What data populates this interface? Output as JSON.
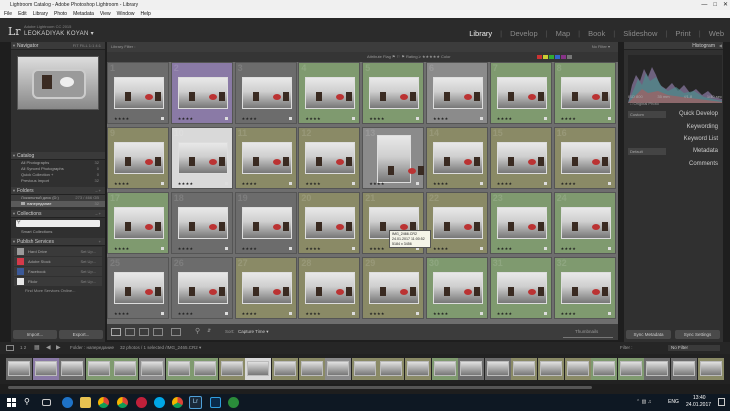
{
  "window": {
    "title": "Lightroom Catalog - Adobe Photoshop Lightroom - Library"
  },
  "menu": [
    "File",
    "Edit",
    "Library",
    "Photo",
    "Metadata",
    "View",
    "Window",
    "Help"
  ],
  "identity": {
    "product": "Adobe Lightroom CC 2015",
    "user": "LEOKADIYAK KOYAN ▾"
  },
  "modules": [
    {
      "label": "Library",
      "active": true
    },
    {
      "label": "Develop"
    },
    {
      "label": "Map"
    },
    {
      "label": "Book"
    },
    {
      "label": "Slideshow"
    },
    {
      "label": "Print"
    },
    {
      "label": "Web"
    }
  ],
  "left": {
    "navigator": "Navigator",
    "nav_opts": "FIT   FILL   1:1   4:1",
    "catalog": "Catalog",
    "catalog_items": [
      {
        "label": "All Photographs",
        "count": "32"
      },
      {
        "label": "All Synced Photographs",
        "count": "0"
      },
      {
        "label": "Quick Collection +",
        "count": "0"
      },
      {
        "label": "Previous Import",
        "count": "32"
      }
    ],
    "folders": "Folders",
    "volume": "Локальный диск (D:)",
    "volume_space": "273 / 466 GB",
    "folder": "напередание",
    "folder_count": "32",
    "collections": "Collections",
    "smart_collections": "Smart Collections",
    "publish": "Publish Services",
    "services": [
      {
        "label": "Hard Drive",
        "state": "Set Up..."
      },
      {
        "label": "Adobe Stock",
        "state": "Set Up..."
      },
      {
        "label": "Facebook",
        "state": "Set Up..."
      },
      {
        "label": "Flickr",
        "state": "Set Up..."
      }
    ],
    "find_more": "Find More Services Online...",
    "import": "Import...",
    "export": "Export..."
  },
  "filter": {
    "label": "Library Filter :",
    "tabs": [
      "Text",
      "Attribute",
      "Metadata",
      "None"
    ],
    "active": "Attribute",
    "nofilter": "No Filter ▾",
    "attr_row": "Attribute   Flag  ⚑ ⚐ ⚑   Rating  ≥ ★★★★★   Color"
  },
  "grid": {
    "cells": [
      {
        "n": "1",
        "c": "#6c6c6c",
        "t": "land"
      },
      {
        "n": "2",
        "c": "#8a7aa6",
        "t": "land"
      },
      {
        "n": "3",
        "c": "#6c6c6c",
        "t": "land"
      },
      {
        "n": "4",
        "c": "#7f9a6f",
        "t": "land"
      },
      {
        "n": "5",
        "c": "#7f9a6f",
        "t": "land"
      },
      {
        "n": "6",
        "c": "#8b8b8b",
        "t": "land"
      },
      {
        "n": "7",
        "c": "#7f9a6f",
        "t": "land"
      },
      {
        "n": "8",
        "c": "#7f9a6f",
        "t": "land"
      },
      {
        "n": "9",
        "c": "#8a8a66",
        "t": "land"
      },
      {
        "n": "10",
        "c": "#d9d9d9",
        "t": "land"
      },
      {
        "n": "11",
        "c": "#8a8a66",
        "t": "land"
      },
      {
        "n": "12",
        "c": "#8a8a66",
        "t": "land"
      },
      {
        "n": "13",
        "c": "#8b8b8b",
        "t": "port"
      },
      {
        "n": "14",
        "c": "#8a8a66",
        "t": "land"
      },
      {
        "n": "15",
        "c": "#8a8a66",
        "t": "land"
      },
      {
        "n": "16",
        "c": "#8a8a66",
        "t": "land"
      },
      {
        "n": "17",
        "c": "#7f9a6f",
        "t": "land"
      },
      {
        "n": "18",
        "c": "#6c6c6c",
        "t": "land"
      },
      {
        "n": "19",
        "c": "#6c6c6c",
        "t": "land"
      },
      {
        "n": "20",
        "c": "#8a8a66",
        "t": "land"
      },
      {
        "n": "21",
        "c": "#8a8a66",
        "t": "land"
      },
      {
        "n": "22",
        "c": "#8a8a66",
        "t": "land"
      },
      {
        "n": "23",
        "c": "#7f9a6f",
        "t": "land"
      },
      {
        "n": "24",
        "c": "#7f9a6f",
        "t": "land"
      },
      {
        "n": "25",
        "c": "#6c6c6c",
        "t": "land"
      },
      {
        "n": "26",
        "c": "#6c6c6c",
        "t": "land"
      },
      {
        "n": "27",
        "c": "#8a8a66",
        "t": "land"
      },
      {
        "n": "28",
        "c": "#8a8a66",
        "t": "land"
      },
      {
        "n": "29",
        "c": "#8a8a66",
        "t": "land"
      },
      {
        "n": "30",
        "c": "#7f9a6f",
        "t": "land"
      },
      {
        "n": "31",
        "c": "#7f9a6f",
        "t": "land"
      },
      {
        "n": "32",
        "c": "#7f9a6f",
        "t": "land"
      }
    ],
    "stars": "★★★★"
  },
  "tooltip": {
    "line1": "IMG_2466.CR2",
    "line2": "24.01.2017 11:00:52",
    "line3": "5184 x 3456"
  },
  "toolbar": {
    "sort_label": "Sort:",
    "sort_value": "Capture Time ▾",
    "thumbs": "Thumbnails"
  },
  "right": {
    "histogram": "Histogram",
    "exif": [
      "ISO 800",
      "35 mm",
      "f/1.8",
      "1/40 sec"
    ],
    "original": "Original Photo",
    "quick_develop": "Quick Develop",
    "custom": "Custom",
    "keywording": "Keywording",
    "keyword_list": "Keyword List",
    "metadata": "Metadata",
    "default": "Default",
    "comments": "Comments",
    "sync_meta": "Sync Metadata",
    "sync_settings": "Sync Settings"
  },
  "filmstrip": {
    "pages": "1  2",
    "path": "Folder : напередание",
    "summary": "32 photos / 1 selected /IMG_2465.CR2 ▾",
    "filter": "Filter :",
    "nofilter": "No Filter"
  },
  "taskbar": {
    "lang": "ENG",
    "time": "13:40",
    "date": "24.01.2017"
  }
}
